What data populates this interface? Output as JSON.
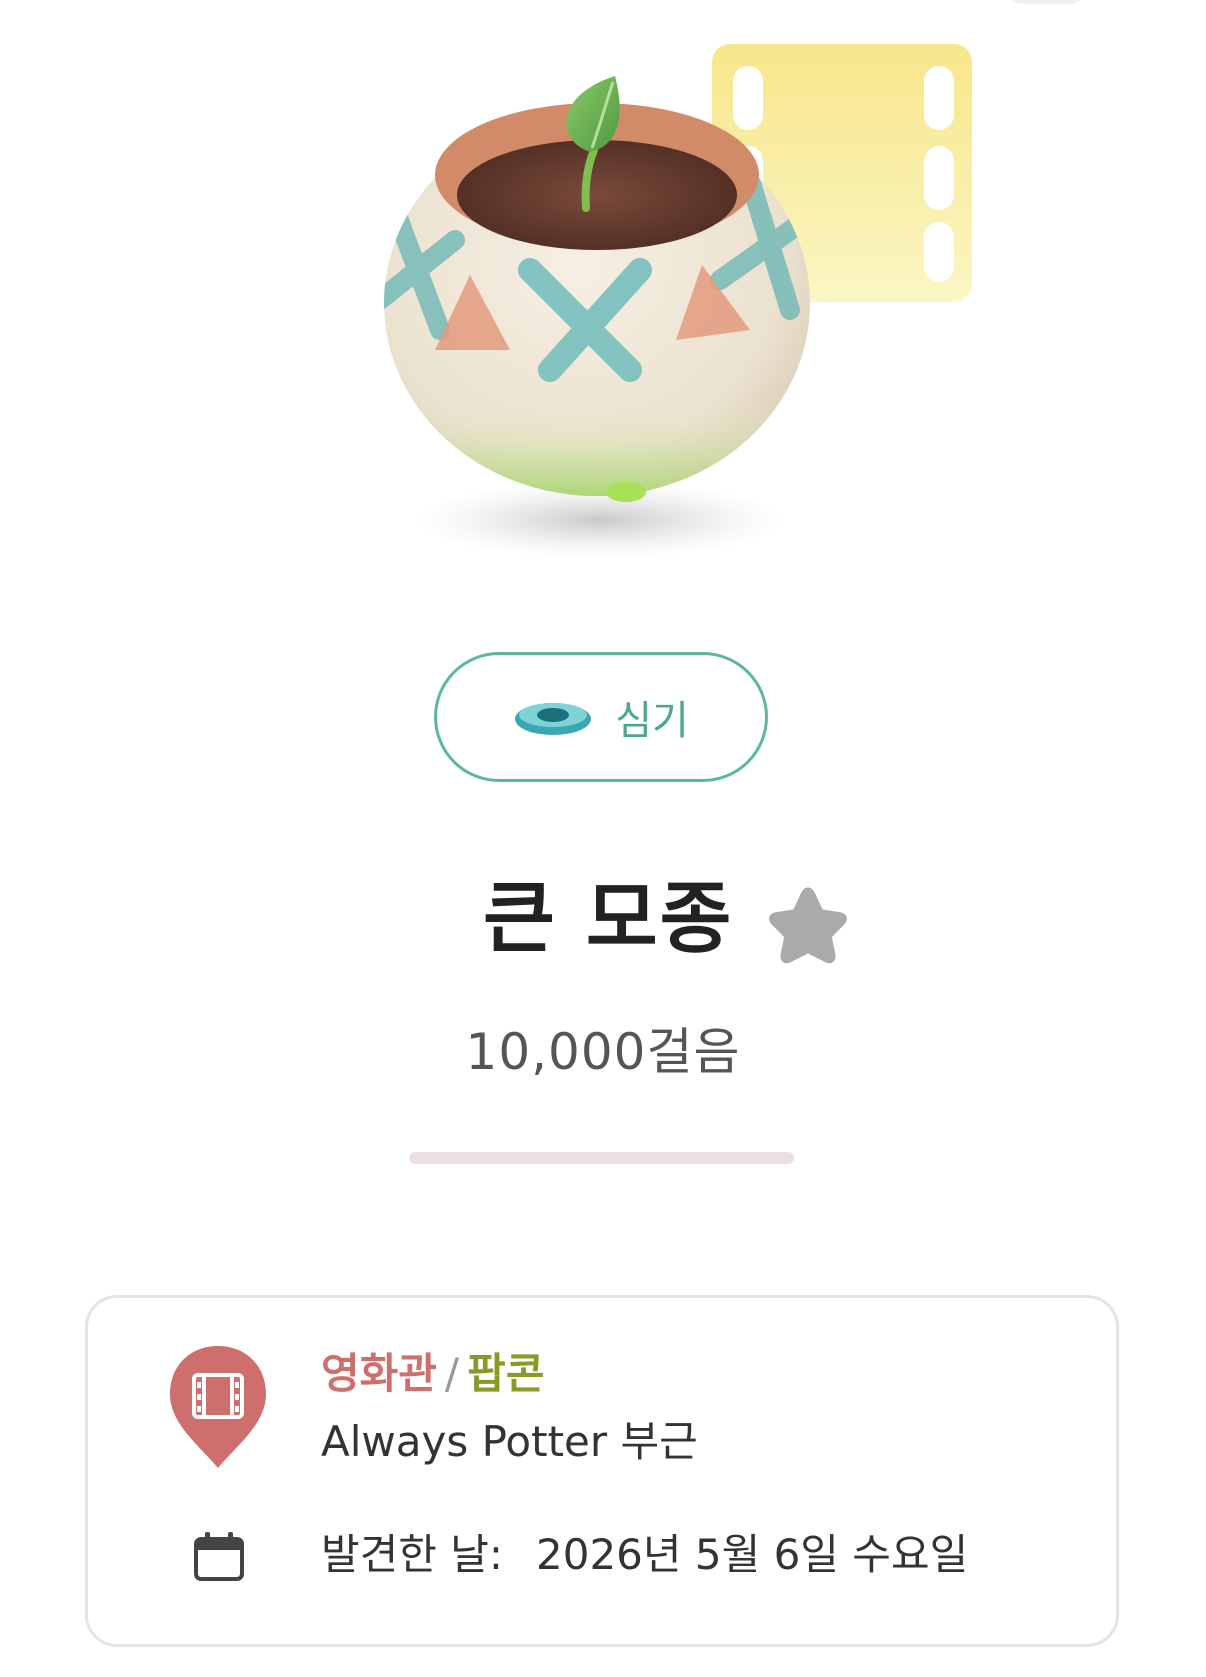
{
  "item": {
    "name": "큰 모종",
    "steps": "10,000걸음",
    "favorite_icon": "star-icon",
    "image": "potted-seedling-with-film-strip"
  },
  "action": {
    "plant_label": "심기",
    "plant_icon": "pot-icon"
  },
  "discovery": {
    "place_type": "영화관",
    "separator": "/",
    "place_subtype": "팝콘",
    "location": "Always Potter 부근",
    "found_label": "발견한 날:",
    "found_date": "2026년 5월 6일 수요일",
    "pin_icon": "movie-theater-pin-icon",
    "date_icon": "calendar-icon"
  },
  "colors": {
    "accent_green": "#5cb89a",
    "place_type": "#cf6f6d",
    "place_subtype": "#8a9a26",
    "star": "#aaaaaa",
    "pin": "#cf6f6d"
  }
}
